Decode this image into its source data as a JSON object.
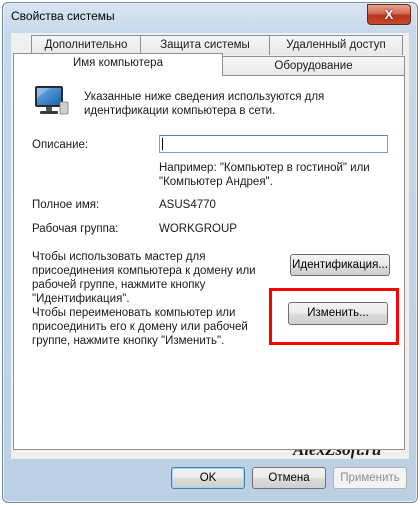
{
  "window": {
    "title": "Свойства системы",
    "close_label": "X"
  },
  "tabs": [
    {
      "label": "Дополнительно"
    },
    {
      "label": "Защита системы"
    },
    {
      "label": "Удаленный доступ"
    },
    {
      "label": "Имя компьютера"
    },
    {
      "label": "Оборудование"
    }
  ],
  "panel": {
    "intro": "Указанные ниже сведения используются для идентификации компьютера в сети.",
    "description_label": "Описание:",
    "description_value": "",
    "example": "Например: \"Компьютер в гостиной\" или \"Компьютер Андрея\".",
    "fullname_label": "Полное имя:",
    "fullname_value": "ASUS4770",
    "workgroup_label": "Рабочая группа:",
    "workgroup_value": "WORKGROUP",
    "wizard_text": "Чтобы использовать мастер для присоединения компьютера к домену или рабочей группе, нажмите кнопку \"Идентификация\".",
    "id_button": "Идентификация...",
    "rename_text": "Чтобы переименовать компьютер или присоединить его к домену или рабочей группе, нажмите кнопку \"Изменить\".",
    "change_button": "Изменить..."
  },
  "buttons": {
    "ok": "OK",
    "cancel": "Отмена",
    "apply": "Применить"
  },
  "watermark": "AlexZsoft.ru",
  "colors": {
    "highlight": "#ff0000",
    "close_button": "#c7432a"
  },
  "icons": {
    "computer": "computer-monitor-icon"
  }
}
